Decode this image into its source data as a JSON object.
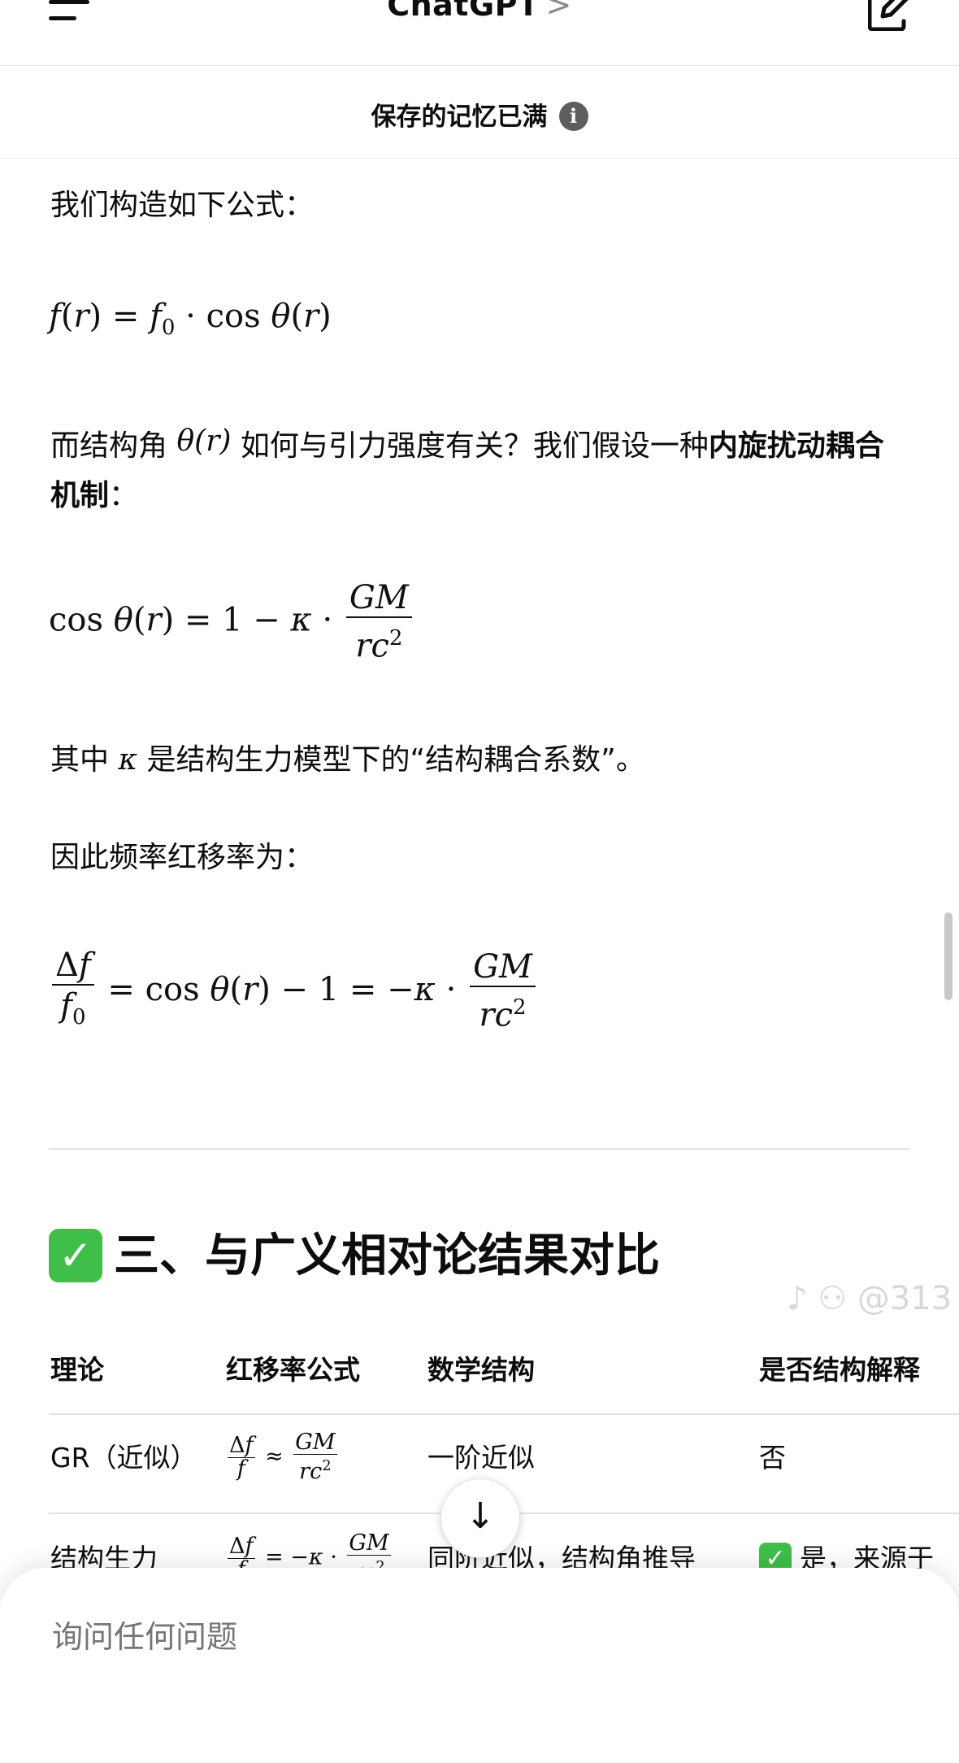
{
  "header": {
    "app_title": "ChatGPT",
    "chevron": ">",
    "menu_icon": "hamburger-menu-icon",
    "edit_icon": "new-chat-edit-icon"
  },
  "banner": {
    "text": "保存的记忆已满",
    "info_glyph": "i"
  },
  "content": {
    "p1": "我们构造如下公式：",
    "p2_pre": "而结构角",
    "p2_mid": "如何与引力强度有关？我们假设一种",
    "p2_bold": "内旋扰动耦合机制",
    "p2_post": "：",
    "p3_pre": "其中",
    "p3_post": "是结构生力模型下的“结构耦合系数”。",
    "p4": "因此频率红移率为："
  },
  "section": {
    "check_glyph": "✓",
    "title": "三、与广义相对论结果对比"
  },
  "watermark": "♪ ⚇ @313",
  "table": {
    "headers": [
      "理论",
      "红移率公式",
      "数学结构",
      "是否结构解释"
    ],
    "rows": [
      {
        "theory": "GR（近似）",
        "structure": "一阶近似",
        "explain": "否"
      },
      {
        "theory": "结构生力",
        "structure": "同阶近似，结构角推导",
        "explain": "是，来源于"
      }
    ]
  },
  "scroll_down_glyph": "↓",
  "composer": {
    "placeholder": "询问任何问题"
  }
}
